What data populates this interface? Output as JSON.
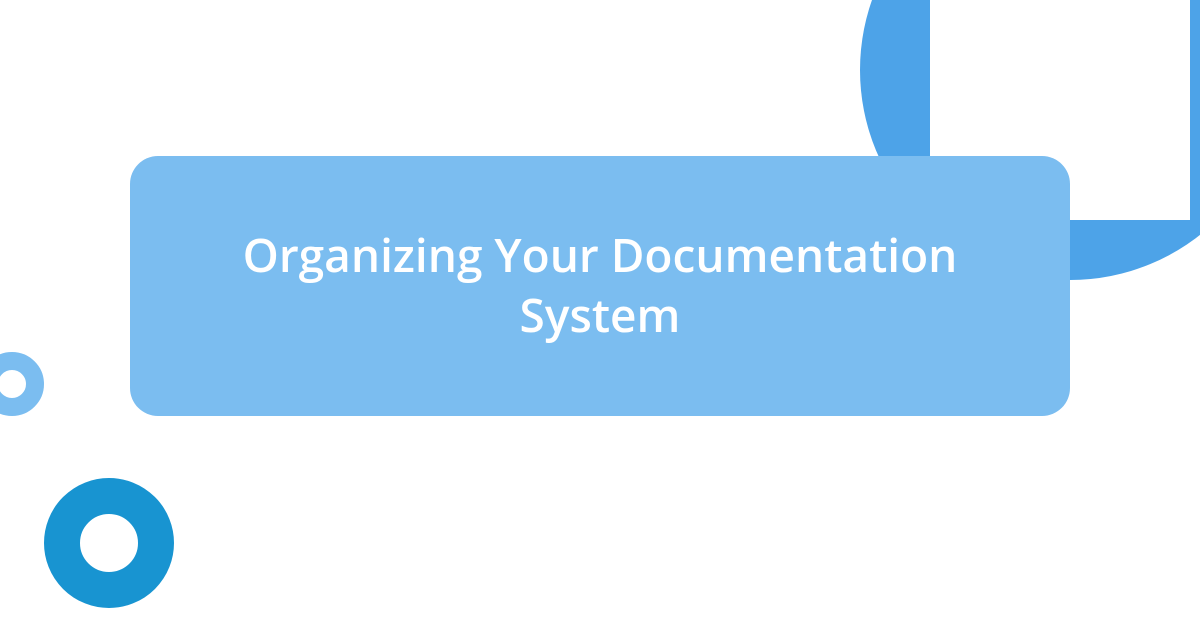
{
  "title": "Organizing Your Documentation System",
  "colors": {
    "card_bg": "#7bbdf0",
    "accent_light": "#7bbdf0",
    "accent_dark": "#1894d1",
    "top_shape": "#4da3e8"
  }
}
